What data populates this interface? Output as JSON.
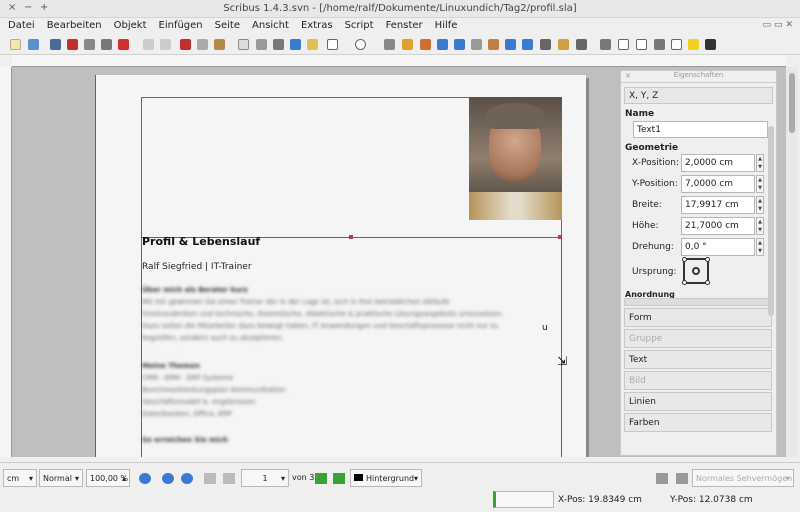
{
  "window": {
    "title": "Scribus 1.4.3.svn - [/home/ralf/Dokumente/Linuxundich/Tag2/profil.sla]",
    "controls": [
      "×",
      "−",
      "+"
    ]
  },
  "menu": [
    "Datei",
    "Bearbeiten",
    "Objekt",
    "Einfügen",
    "Seite",
    "Ansicht",
    "Extras",
    "Script",
    "Fenster",
    "Hilfe"
  ],
  "document": {
    "heading": "Profil & Lebenslauf",
    "subheading": "Ralf Siegfried | IT-Trainer",
    "blurred_lines": [
      {
        "text": "Über mich als Berater kurz",
        "bold": true
      },
      {
        "text": "Mit mir gewinnen Sie einen Trainer der in der Lage ist, sich in Ihre betrieblichen Abläufe",
        "bold": false
      },
      {
        "text": "hineinzudenken und technische, theoretische, didaktische & praktische Lösungsangebote umzusetzen.",
        "bold": false
      },
      {
        "text": "Dazu sollen die Mitarbeiter dazu bewegt haben, IT Anwendungen und Geschäftsprozesse nicht nur zu",
        "bold": false
      },
      {
        "text": "begreifen, sondern auch zu akzeptieren.",
        "bold": false
      },
      {
        "text": "Meine Themen",
        "bold": true
      },
      {
        "text": "CRM - ERM - ERP Systeme",
        "bold": false
      },
      {
        "text": "Benchmarkleistungsplan Kommunikation",
        "bold": false
      },
      {
        "text": "Geschäftsmodell & -ergebnissen",
        "bold": false
      },
      {
        "text": "Datenbanken, Office, ERP",
        "bold": false
      },
      {
        "text": "So erreichen Sie mich",
        "bold": true
      }
    ],
    "stray_char": "u"
  },
  "panel": {
    "title": "Eigenschaften",
    "xyz_tab": "X, Y, Z",
    "name_label": "Name",
    "name_value": "Text1",
    "geometry_label": "Geometrie",
    "fields": [
      {
        "label": "X-Position:",
        "value": "2,0000 cm"
      },
      {
        "label": "Y-Position:",
        "value": "7,0000 cm"
      },
      {
        "label": "Breite:",
        "value": "17,9917 cm"
      },
      {
        "label": "Höhe:",
        "value": "21,7000 cm"
      },
      {
        "label": "Drehung:",
        "value": "0,0 °"
      }
    ],
    "origin_label": "Ursprung:",
    "cut_label": "Anordnung",
    "sections": [
      {
        "label": "Form",
        "disabled": false
      },
      {
        "label": "Gruppe",
        "disabled": true
      },
      {
        "label": "Text",
        "disabled": false
      },
      {
        "label": "Bild",
        "disabled": true
      },
      {
        "label": "Linien",
        "disabled": false
      },
      {
        "label": "Farben",
        "disabled": false
      }
    ]
  },
  "status": {
    "unit": "cm",
    "mode": "Normal",
    "zoom": "100,00 %",
    "page": "1",
    "page_of": "von 3",
    "layer": "Hintergrund",
    "view": "Normales Sehvermögen",
    "xpos": "X-Pos: 19.8349 cm",
    "ypos": "Y-Pos: 12.0738 cm"
  },
  "colors": {
    "accent_red": "#c0394b",
    "accent_blue": "#4466cc",
    "layer_swatch": "#000000"
  }
}
